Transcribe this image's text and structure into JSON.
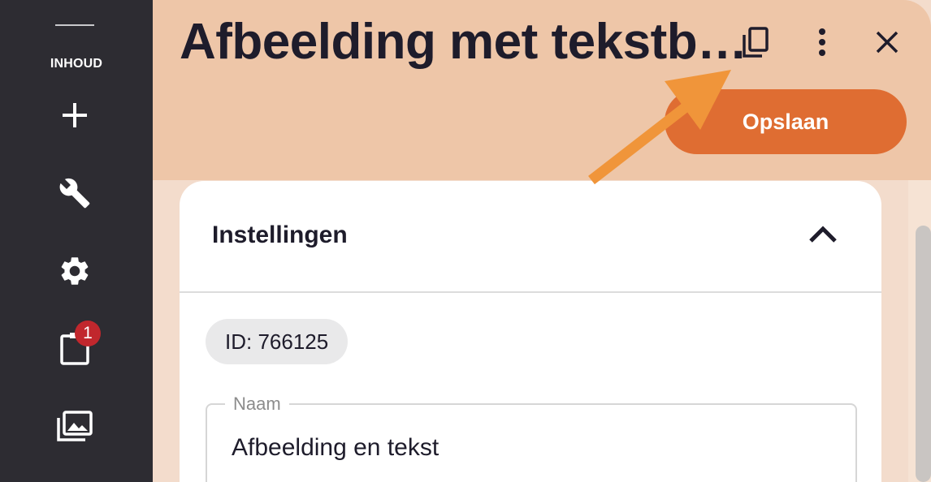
{
  "sidebar": {
    "section_label": "INHOUD",
    "items": [
      {
        "name": "add",
        "icon": "plus-icon"
      },
      {
        "name": "tools",
        "icon": "wrench-icon"
      },
      {
        "name": "settings",
        "icon": "gear-icon"
      },
      {
        "name": "clipboard",
        "icon": "clipboard-icon",
        "badge": "1"
      },
      {
        "name": "media",
        "icon": "image-library-icon"
      }
    ]
  },
  "header": {
    "title": "Afbeelding met tekstb…",
    "save_label": "Opslaan",
    "icons": [
      "copy-icon",
      "more-vertical-icon",
      "close-icon"
    ]
  },
  "settings_card": {
    "title": "Instellingen",
    "id_chip": "ID: 766125",
    "name_field": {
      "label": "Naam",
      "value": "Afbeelding en tekst"
    }
  },
  "colors": {
    "sidebar_bg": "#2d2c32",
    "header_bg": "#eec6a8",
    "accent": "#df6d32",
    "annotation_arrow": "#f0953a",
    "badge": "#c1272d",
    "text_dark": "#1e1c2b"
  }
}
